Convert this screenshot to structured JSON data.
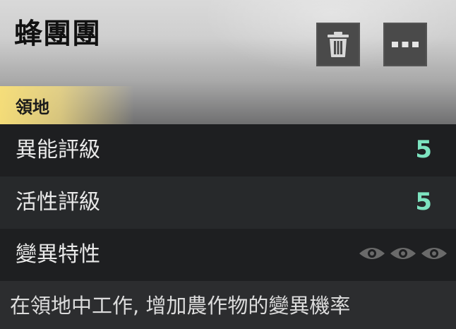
{
  "header": {
    "title": "蜂團團"
  },
  "actions": {
    "delete_icon": "trash-icon",
    "more_icon": "more-dots-icon"
  },
  "section": {
    "tab_label": "領地"
  },
  "stats": [
    {
      "label": "異能評級",
      "value": "5"
    },
    {
      "label": "活性評級",
      "value": "5"
    },
    {
      "label": "變異特性",
      "value_icons": [
        "eye-icon",
        "eye-icon",
        "eye-icon"
      ]
    }
  ],
  "description": "在領地中工作, 增加農作物的變異機率",
  "colors": {
    "value_accent": "#7de3c0",
    "eye_icon": "#6a6a6a",
    "tab_highlight": "#f6de80"
  }
}
